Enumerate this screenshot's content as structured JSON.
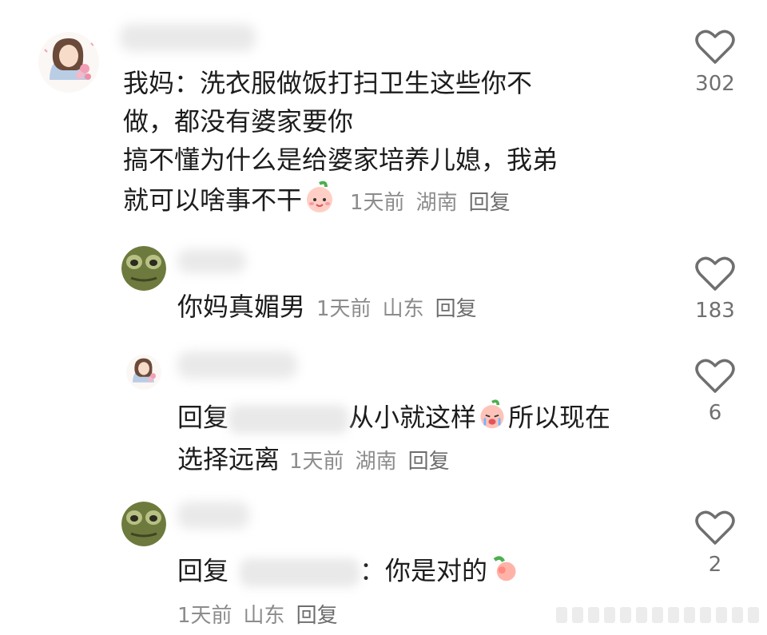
{
  "comments": [
    {
      "text_lines": [
        "我妈：洗衣服做饭打扫卫生这些你不",
        "做，都没有婆家要你",
        "搞不懂为什么是给婆家培养儿媳，我弟",
        "就可以啥事不干"
      ],
      "time": "1天前",
      "location": "湖南",
      "reply_label": "回复",
      "likes": "302"
    },
    {
      "text": "你妈真媚男",
      "time": "1天前",
      "location": "山东",
      "reply_label": "回复",
      "likes": "183"
    },
    {
      "prefix": "回复",
      "text_line1": "从小就这样",
      "text_line1b": "所以现在",
      "text_line2": "选择远离",
      "time": "1天前",
      "location": "湖南",
      "reply_label": "回复",
      "likes": "6"
    },
    {
      "prefix": "回复",
      "text": "：你是对的",
      "time": "1天前",
      "location": "山东",
      "reply_label": "回复",
      "likes": "2"
    }
  ],
  "icons": {
    "like": "heart-outline-icon",
    "avatar_girl": "girl-with-flowers-avatar",
    "avatar_frog": "frog-avatar"
  },
  "colors": {
    "text": "#1c1c1c",
    "meta": "#8c8c8c",
    "heart": "#6f6f6f"
  }
}
